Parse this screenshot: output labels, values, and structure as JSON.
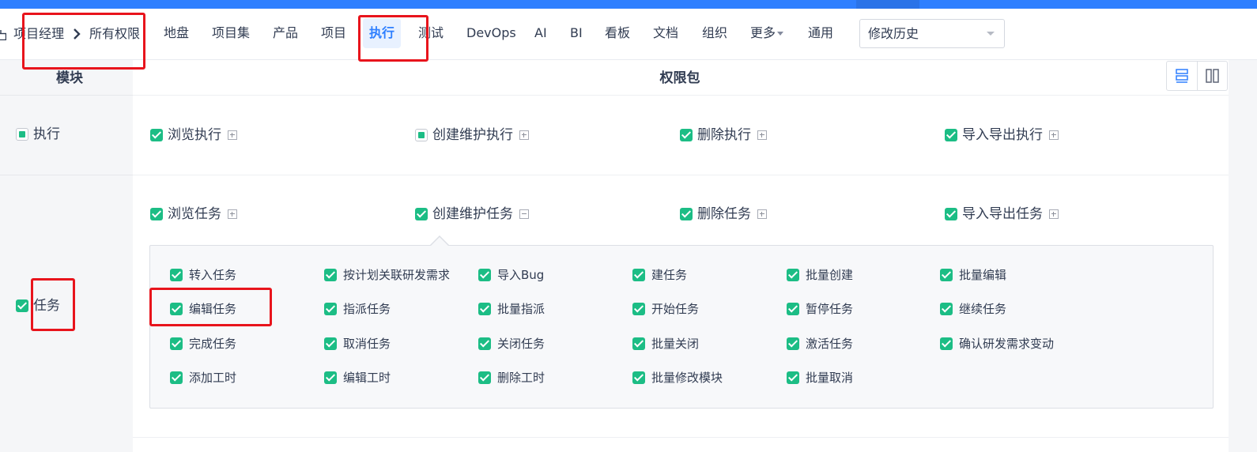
{
  "breadcrumb": {
    "role": "项目经理",
    "page": "所有权限"
  },
  "nav": {
    "items": [
      "地盘",
      "项目集",
      "产品",
      "项目",
      "执行",
      "测试",
      "DevOps",
      "AI",
      "BI",
      "看板",
      "文档",
      "组织",
      "更多",
      "通用"
    ],
    "active": "执行"
  },
  "history_select": {
    "value": "修改历史"
  },
  "table": {
    "module_header": "模块",
    "package_header": "权限包"
  },
  "modules": {
    "execution": {
      "label": "执行",
      "state": "partial",
      "packages": [
        {
          "label": "浏览执行",
          "state": "checked",
          "expanded": false
        },
        {
          "label": "创建维护执行",
          "state": "partial",
          "expanded": false
        },
        {
          "label": "删除执行",
          "state": "checked",
          "expanded": false
        },
        {
          "label": "导入导出执行",
          "state": "checked",
          "expanded": false
        }
      ]
    },
    "task": {
      "label": "任务",
      "state": "checked",
      "packages": [
        {
          "label": "浏览任务",
          "state": "checked",
          "expanded": false
        },
        {
          "label": "创建维护任务",
          "state": "checked",
          "expanded": true
        },
        {
          "label": "删除任务",
          "state": "checked",
          "expanded": false
        },
        {
          "label": "导入导出任务",
          "state": "checked",
          "expanded": false
        }
      ],
      "privileges": [
        "转入任务",
        "按计划关联研发需求",
        "导入Bug",
        "建任务",
        "批量创建",
        "批量编辑",
        "编辑任务",
        "指派任务",
        "批量指派",
        "开始任务",
        "暂停任务",
        "继续任务",
        "完成任务",
        "取消任务",
        "关闭任务",
        "批量关闭",
        "激活任务",
        "确认研发需求变动",
        "添加工时",
        "编辑工时",
        "删除工时",
        "批量修改模块",
        "批量取消"
      ]
    }
  },
  "colors": {
    "accent": "#2e7fff",
    "check": "#1cbd85",
    "highlight": "#e8141c"
  }
}
